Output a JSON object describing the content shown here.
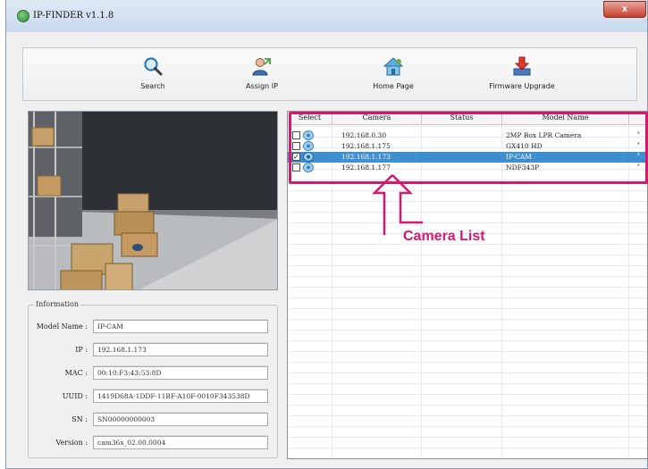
{
  "window": {
    "title": "IP-FINDER v1.1.8",
    "close_label": "x"
  },
  "toolbar": {
    "search_label": "Search",
    "assign_ip_label": "Assign IP",
    "home_page_label": "Home Page",
    "firmware_upgrade_label": "Firmware Upgrade"
  },
  "info": {
    "legend": "Information",
    "fields": [
      {
        "label": "Model Name :",
        "value": "IP-CAM"
      },
      {
        "label": "IP :",
        "value": "192.168.1.173"
      },
      {
        "label": "MAC :",
        "value": "00:10:F3:43:53:8D"
      },
      {
        "label": "UUID :",
        "value": "1419D68A-1DDF-11BF-A10F-0010F343538D"
      },
      {
        "label": "SN :",
        "value": "SN00000000003"
      },
      {
        "label": "Version :",
        "value": "cam36x_02.00.0004"
      }
    ]
  },
  "camera_list": {
    "columns": [
      "Select",
      "Camera",
      "Status",
      "Model Name"
    ],
    "rows": [
      {
        "checked": false,
        "camera": "192.168.0.30",
        "status": "",
        "model": "2MP Box LPR Camera",
        "selected": false
      },
      {
        "checked": false,
        "camera": "192.168.1.175",
        "status": "",
        "model": "GX410 HD",
        "selected": false
      },
      {
        "checked": true,
        "camera": "192.168.1.173",
        "status": "",
        "model": "IP-CAM",
        "selected": true
      },
      {
        "checked": false,
        "camera": "192.168.1.177",
        "status": "",
        "model": "NDF343P",
        "selected": false
      }
    ],
    "row_marker": "*",
    "check_mark": "✓"
  },
  "annotation": {
    "label": "Camera List",
    "color": "#d8176e"
  },
  "colors": {
    "selection": "#3f8fd2",
    "accent": "#d8176e"
  },
  "icons": {
    "app": "ip-finder-app-icon",
    "search": "magnifier-icon",
    "assign_ip": "user-icon",
    "home_page": "house-icon",
    "firmware": "download-arrow-icon",
    "camera_row": "camera-icon"
  }
}
